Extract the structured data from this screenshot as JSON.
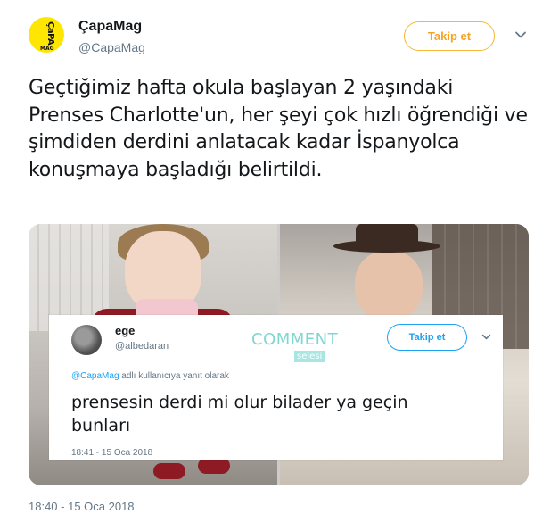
{
  "account": {
    "name": "ÇapaMag",
    "handle": "@CapaMag",
    "avatar_text_vertical": "ÇaPA",
    "avatar_text_small": "MAG",
    "follow_label": "Takip et"
  },
  "tweet": {
    "text": "Geçtiğimiz hafta okula başlayan 2 yaşındaki Prenses Charlotte'un, her şeyi çok hızlı öğrendiği ve şimdiden derdini anlatacak kadar İspanyolca konuşmaya başladığı belirtildi.",
    "timestamp": "18:40 - 15 Oca 2018"
  },
  "reply": {
    "name": "ege",
    "handle": "@albedaran",
    "follow_label": "Takip et",
    "replying_mention": "@CapaMag",
    "replying_suffix": " adlı kullanıcıya yanıt olarak",
    "text": "prensesin derdi mi olur bilader ya geçin bunları",
    "timestamp": "18:41 - 15 Oca 2018"
  },
  "watermark": {
    "title": "COMMENT",
    "subtitle": "selesi"
  },
  "colors": {
    "follow_orange": "#f7b733",
    "twitter_blue": "#1da1f2",
    "avatar_yellow": "#ffe600",
    "watermark_teal": "#7fd6d2"
  },
  "icons": {
    "dropdown": "chevron-down-icon"
  }
}
